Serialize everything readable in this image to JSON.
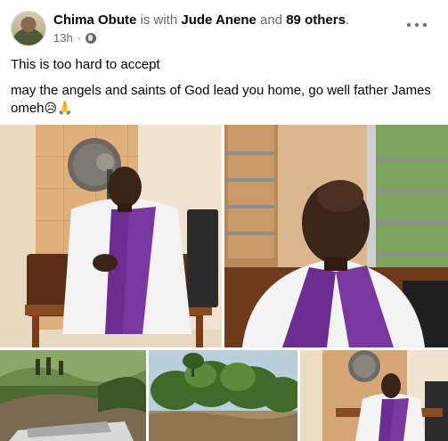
{
  "post": {
    "author": "Chima Obute",
    "connector": "is with",
    "tagged": "Jude Anene",
    "and_word": "and",
    "others": "89 others",
    "period": ".",
    "time": "13h",
    "dot": "·",
    "line1": "This is too hard to accept",
    "line2": "may the angels and saints of God lead you home, go well father James omeh",
    "emojis": "😥🙏"
  },
  "icons": {
    "privacy": "globe-icon",
    "menu": "more-options-icon"
  },
  "colors": {
    "text": "#050505",
    "muted": "#65676b",
    "stole": "#6b2d8f"
  }
}
